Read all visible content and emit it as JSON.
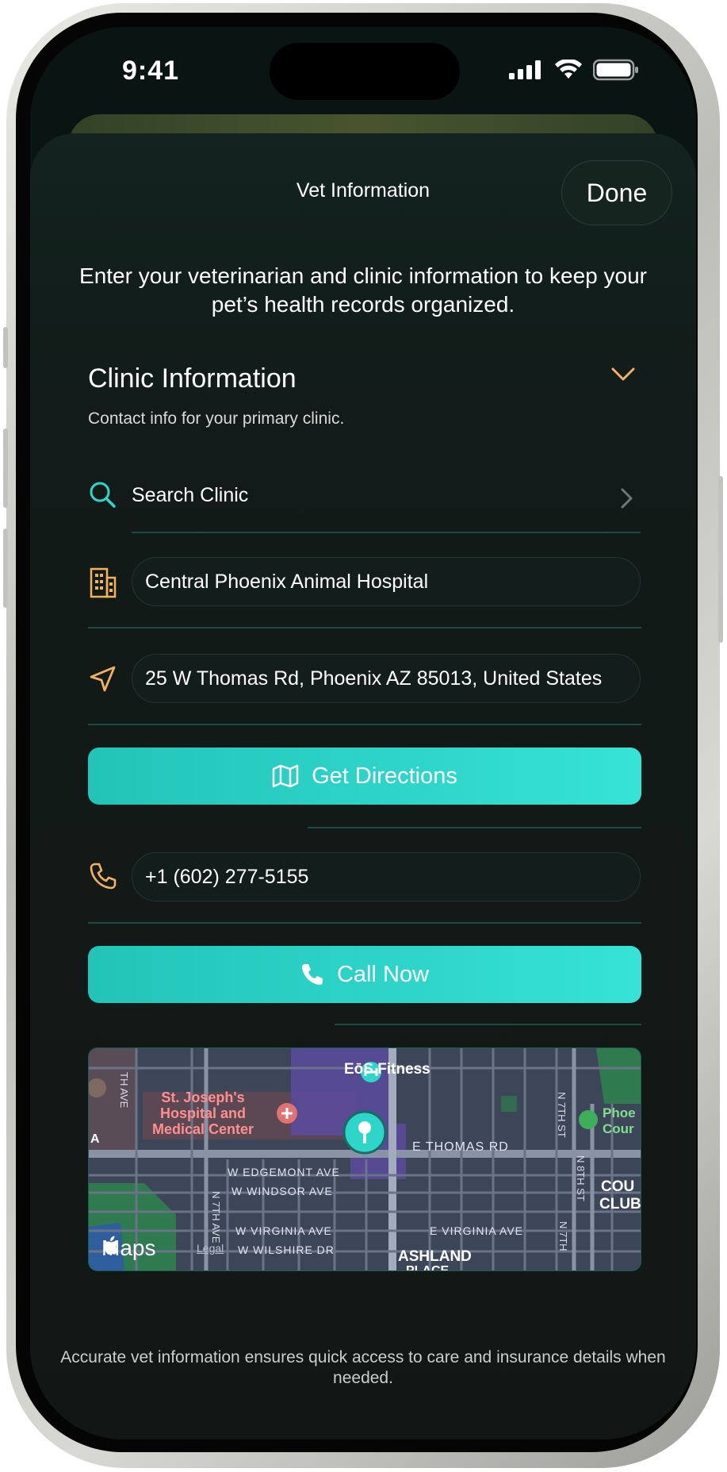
{
  "status_bar": {
    "time": "9:41"
  },
  "header": {
    "title": "Vet Information",
    "done_label": "Done"
  },
  "intro_text": "Enter your veterinarian and clinic information to keep your pet’s health records organized.",
  "section": {
    "title": "Clinic Information",
    "subtitle": "Contact info for your primary clinic."
  },
  "search": {
    "label": "Search Clinic"
  },
  "clinic": {
    "name": "Central Phoenix Animal Hospital",
    "address": "25 W Thomas Rd, Phoenix AZ 85013, United States",
    "phone": "+1 (602) 277-5155"
  },
  "actions": {
    "directions_label": "Get Directions",
    "call_label": "Call Now"
  },
  "map": {
    "poi_fitness": "EōS Fitness",
    "poi_hospital": "St. Joseph's Hospital and Medical Center",
    "hospital_lines": [
      "St. Joseph's",
      "Hospital and",
      "Medical Center"
    ],
    "streets": {
      "thomas": "E THOMAS RD",
      "edgemont": "W EDGEMONT AVE",
      "windsor": "W WINDSOR AVE",
      "virginia_w": "W VIRGINIA AVE",
      "virginia_e": "E VIRGINIA AVE",
      "wilshire": "W WILSHIRE DR",
      "seventh_ave": "N 7TH AVE",
      "th_ave": "TH AVE",
      "seventh_st": "N 7TH ST",
      "eighth_st": "N 8TH ST",
      "seventh_st_lower": "N 7TH"
    },
    "areas": {
      "ashland": "ASHLAND",
      "ashland_place": "PLACE",
      "country_club_1": "COU",
      "country_club_2": "CLUB",
      "phoe_1": "Phoe",
      "phoe_2": "Cour",
      "left_a": "A"
    },
    "brand": "Maps",
    "legal": "Legal"
  },
  "footer_text": "Accurate vet information ensures quick access to care and insurance details when needed.",
  "colors": {
    "accent": "#2ed6c9",
    "icon_orange": "#f2b25c",
    "sheet_bg": "#121b19"
  }
}
